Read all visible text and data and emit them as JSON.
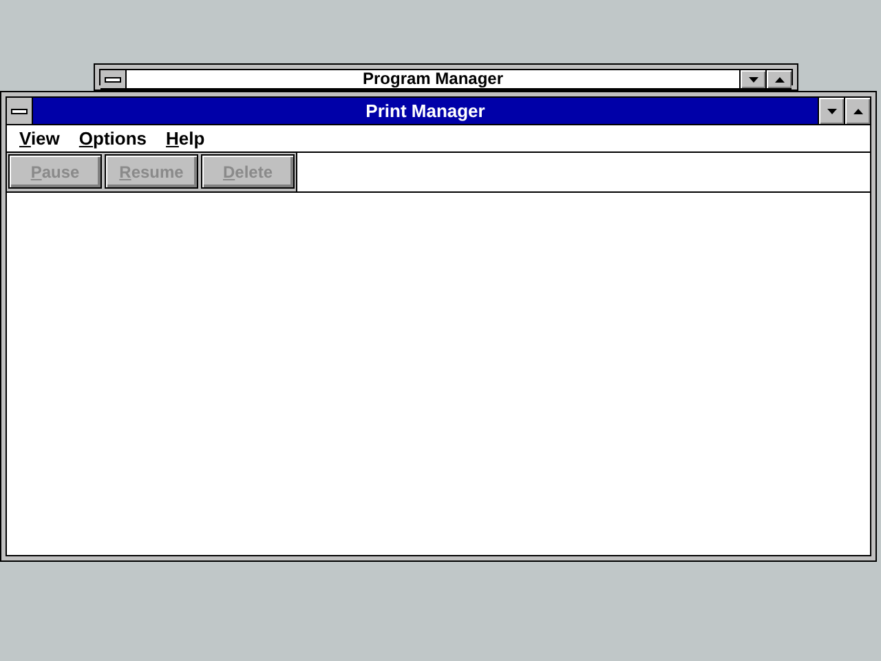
{
  "windows": [
    {
      "title": "Program Manager",
      "active": false
    },
    {
      "title": "Print Manager",
      "active": true,
      "menu": [
        {
          "label": "View"
        },
        {
          "label": "Options"
        },
        {
          "label": "Help"
        }
      ],
      "buttons": [
        {
          "label": "Pause",
          "disabled": true
        },
        {
          "label": "Resume",
          "disabled": true
        },
        {
          "label": "Delete",
          "disabled": true
        }
      ]
    }
  ]
}
